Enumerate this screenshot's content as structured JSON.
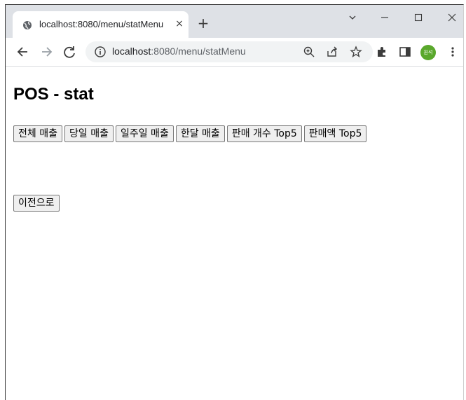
{
  "browser": {
    "tab_title": "localhost:8080/menu/statMenu",
    "new_tab_symbol": "+",
    "close_symbol": "×",
    "url_host": "localhost",
    "url_rest": ":8080/menu/statMenu",
    "profile_initials": "원석",
    "accent_color": "#5aa82c"
  },
  "page": {
    "title": "POS - stat",
    "buttons": [
      {
        "label": "전체 매출"
      },
      {
        "label": "당일 매출"
      },
      {
        "label": "일주일 매출"
      },
      {
        "label": "한달 매출"
      },
      {
        "label": "판매 개수 Top5"
      },
      {
        "label": "판매액 Top5"
      }
    ],
    "back_button": "이전으로"
  }
}
